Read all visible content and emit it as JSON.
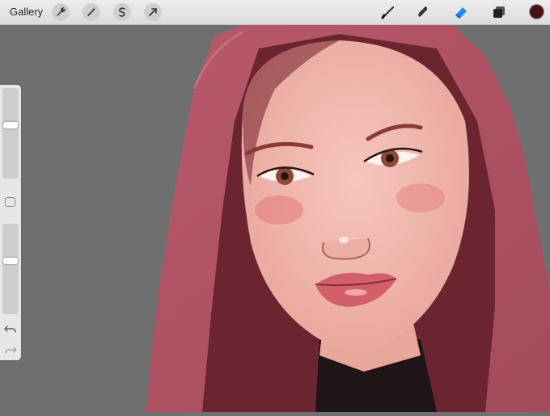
{
  "toolbar": {
    "gallery_label": "Gallery",
    "left_tools": [
      "wrench-icon",
      "magic-wand-icon",
      "selection-s-icon",
      "transform-arrow-icon"
    ],
    "right_tools": [
      "brush-icon",
      "smudge-icon",
      "eraser-icon",
      "layers-icon"
    ],
    "active_tool": "eraser-icon",
    "current_color": "#4a1214",
    "accent_color": "#1a8cff"
  },
  "sidebar": {
    "brush_size_level": 0.6,
    "opacity_level": 0.6,
    "modifier_icon": "square-icon",
    "undo_icon": "undo-icon",
    "redo_icon": "redo-icon"
  },
  "canvas": {
    "background_color": "#6f6f6f",
    "artwork": "portrait-painting"
  }
}
